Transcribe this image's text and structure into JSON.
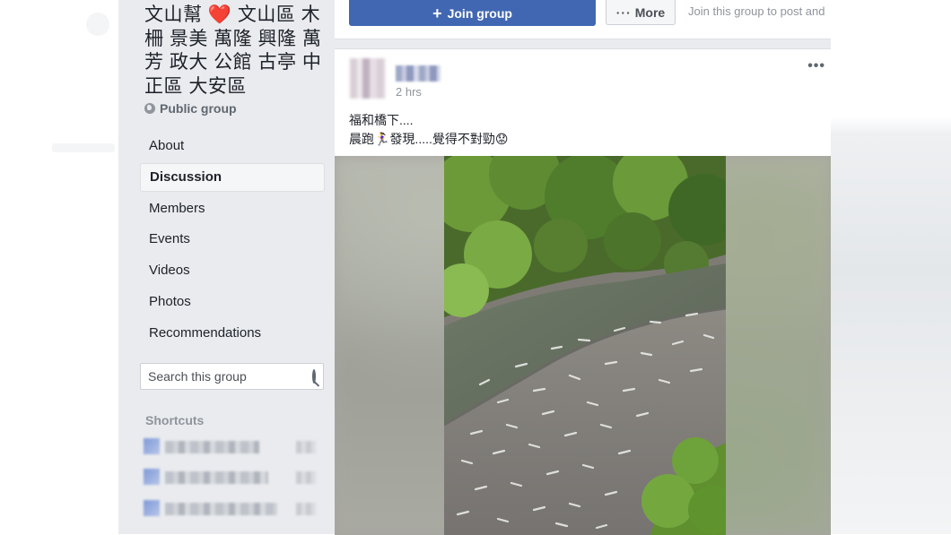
{
  "group": {
    "title_parts": [
      "文山幫 ",
      "❤️",
      " 文山區 木柵 景美 萬隆 興隆 萬芳 政大 公館 古亭 中正區 大安區"
    ],
    "privacy": "Public group"
  },
  "nav": {
    "items": [
      {
        "label": "About"
      },
      {
        "label": "Discussion",
        "active": true
      },
      {
        "label": "Members"
      },
      {
        "label": "Events"
      },
      {
        "label": "Videos"
      },
      {
        "label": "Photos"
      },
      {
        "label": "Recommendations"
      }
    ]
  },
  "search": {
    "placeholder": "Search this group"
  },
  "shortcuts": {
    "title": "Shortcuts"
  },
  "top_bar": {
    "join_label": "Join group",
    "more_label": "More",
    "join_hint": "Join this group to post and"
  },
  "post": {
    "timestamp": "2 hrs",
    "menu": "•••",
    "line1": "福和橋下....",
    "line2_a": "晨跑",
    "line2_emoji": "🏃‍♀️",
    "line2_b": "發現.....覺得不對勁",
    "line2_emoji2": "😟"
  },
  "icons": {
    "globe": "globe-icon",
    "search": "search-icon",
    "plus": "plus-icon",
    "more_dots": "more-dots-icon",
    "post_menu": "post-menu-icon"
  },
  "colors": {
    "brand_blue": "#4267b2",
    "sidebar_bg": "#e9ebee",
    "heart": "#e0245e"
  }
}
